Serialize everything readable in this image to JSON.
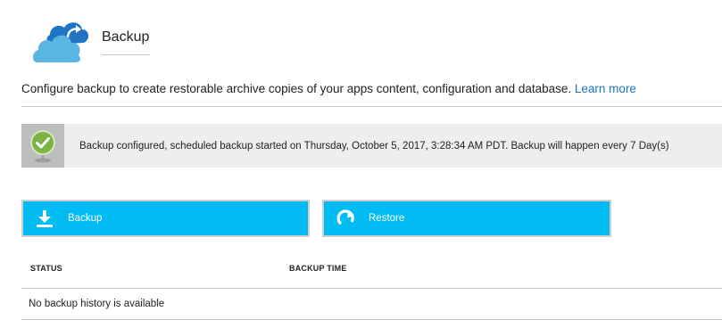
{
  "header": {
    "title": "Backup",
    "icon": "cloud-backup-icon"
  },
  "description": {
    "text": "Configure backup to create restorable archive copies of your apps content, configuration and database.",
    "link_label": "Learn more"
  },
  "status_banner": {
    "icon": "success-check-icon",
    "text": "Backup configured, scheduled backup started on Thursday, October 5, 2017, 3:28:34 AM PDT. Backup will happen every 7 Day(s)"
  },
  "actions": {
    "backup_label": "Backup",
    "restore_label": "Restore"
  },
  "table": {
    "columns": [
      "STATUS",
      "BACKUP TIME"
    ],
    "empty_message": "No backup history is available"
  },
  "colors": {
    "accent": "#00bcf2",
    "link": "#1e73be",
    "success": "#7cb342",
    "cloud_dark": "#1f74c4",
    "cloud_light": "#5bb5e2"
  }
}
